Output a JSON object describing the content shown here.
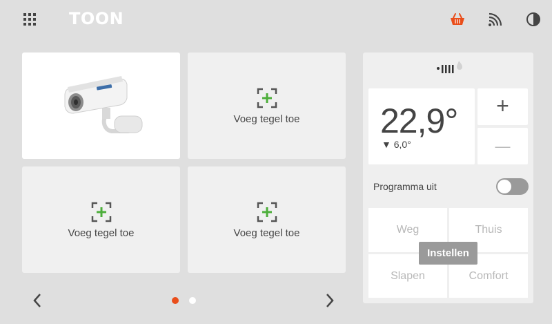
{
  "header": {
    "logo": "TOON",
    "icons": [
      "apps-grid-icon",
      "shopping-basket-icon",
      "wifi-icon",
      "contrast-icon"
    ],
    "basket_color": "#e94e1b"
  },
  "tiles": {
    "camera_tile": {
      "icon": "camera-image"
    },
    "add_label_1": "Voeg tegel toe",
    "add_label_2": "Voeg tegel toe",
    "add_label_3": "Voeg tegel toe",
    "add_icon_color": "#4cae3a"
  },
  "pager": {
    "pages": 2,
    "active_page": 1,
    "active_color": "#e94e1b",
    "inactive_color": "#ffffff"
  },
  "thermostat": {
    "status_icon": "heating-indicator-icon",
    "temperature": "22,9°",
    "target": "▼ 6,0°",
    "plus": "+",
    "minus": "—",
    "program_label": "Programma uit",
    "program_on": false,
    "modes": {
      "away": "Weg",
      "home": "Thuis",
      "sleep": "Slapen",
      "comfort": "Comfort"
    },
    "set_button": "Instellen"
  }
}
